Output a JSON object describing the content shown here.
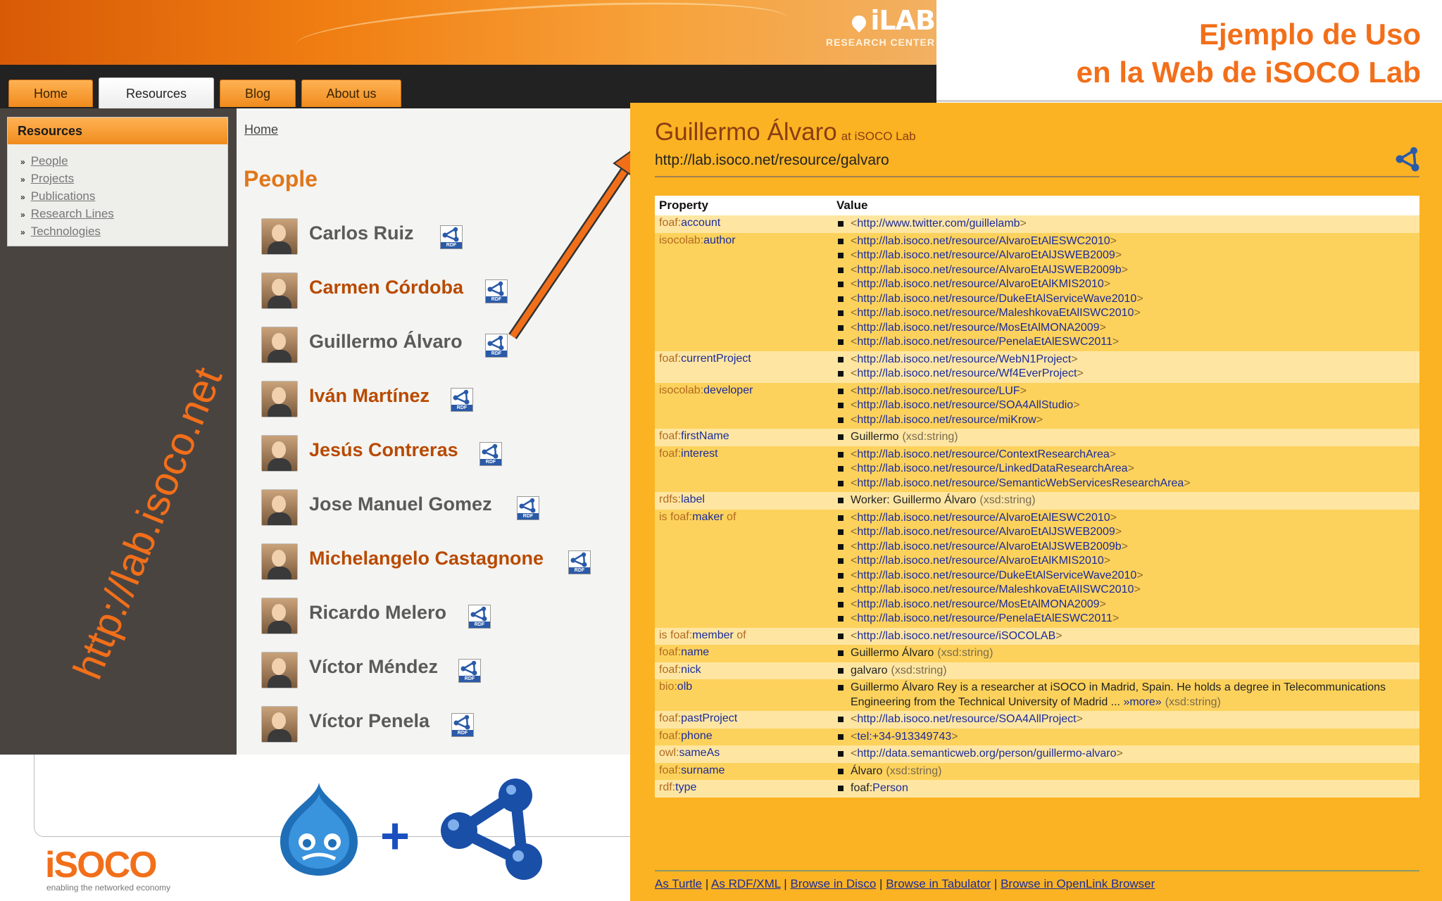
{
  "site": {
    "logo": "iLAB",
    "logo_sub": "RESEARCH CENTER",
    "nav": [
      "Home",
      "Resources",
      "Blog",
      "About us"
    ],
    "active_tab": "Resources"
  },
  "sidebar": {
    "heading": "Resources",
    "items": [
      "People",
      "Projects",
      "Publications",
      "Research Lines",
      "Technologies"
    ]
  },
  "rotated_url": "http://lab.isoco.net",
  "breadcrumb": "Home",
  "page_title": "People",
  "people": [
    {
      "name": "Carlos Ruiz",
      "highlight": false
    },
    {
      "name": "Carmen Córdoba",
      "highlight": true
    },
    {
      "name": "Guillermo Álvaro",
      "highlight": false
    },
    {
      "name": "Iván Martínez",
      "highlight": true
    },
    {
      "name": "Jesús Contreras",
      "highlight": true
    },
    {
      "name": "Jose Manuel Gomez",
      "highlight": false
    },
    {
      "name": "Michelangelo Castagnone",
      "highlight": true
    },
    {
      "name": "Ricardo Melero",
      "highlight": false
    },
    {
      "name": "Víctor Méndez",
      "highlight": false
    },
    {
      "name": "Víctor Penela",
      "highlight": false
    }
  ],
  "rdf_icon_label": "RDF",
  "slide_title": [
    "Ejemplo de Uso",
    "en la Web de iSOCO Lab"
  ],
  "isoco": {
    "logo": "iSOCO",
    "tagline": "enabling the networked economy"
  },
  "plus_sign": "+",
  "resource": {
    "name": "Guillermo Álvaro",
    "at": "at iSOCO Lab",
    "uri": "http://lab.isoco.net/resource/galvaro",
    "columns": [
      "Property",
      "Value"
    ],
    "rows": [
      {
        "prefix": "foaf:",
        "local": "account",
        "suffix": "",
        "values": [
          {
            "uri": "http://www.twitter.com/guillelamb"
          }
        ]
      },
      {
        "prefix": "isocolab:",
        "local": "author",
        "suffix": "",
        "values": [
          {
            "uri": "http://lab.isoco.net/resource/AlvaroEtAlESWC2010"
          },
          {
            "uri": "http://lab.isoco.net/resource/AlvaroEtAlJSWEB2009"
          },
          {
            "uri": "http://lab.isoco.net/resource/AlvaroEtAlJSWEB2009b"
          },
          {
            "uri": "http://lab.isoco.net/resource/AlvaroEtAlKMIS2010"
          },
          {
            "uri": "http://lab.isoco.net/resource/DukeEtAlServiceWave2010"
          },
          {
            "uri": "http://lab.isoco.net/resource/MaleshkovaEtAlISWC2010"
          },
          {
            "uri": "http://lab.isoco.net/resource/MosEtAlMONA2009"
          },
          {
            "uri": "http://lab.isoco.net/resource/PenelaEtAlESWC2011"
          }
        ]
      },
      {
        "prefix": "foaf:",
        "local": "currentProject",
        "suffix": "",
        "values": [
          {
            "uri": "http://lab.isoco.net/resource/WebN1Project"
          },
          {
            "uri": "http://lab.isoco.net/resource/Wf4EverProject"
          }
        ]
      },
      {
        "prefix": "isocolab:",
        "local": "developer",
        "suffix": "",
        "values": [
          {
            "uri": "http://lab.isoco.net/resource/LUF"
          },
          {
            "uri": "http://lab.isoco.net/resource/SOA4AllStudio"
          },
          {
            "uri": "http://lab.isoco.net/resource/miKrow"
          }
        ]
      },
      {
        "prefix": "foaf:",
        "local": "firstName",
        "suffix": "",
        "values": [
          {
            "text": "Guillermo",
            "dt": "(xsd:string)"
          }
        ]
      },
      {
        "prefix": "foaf:",
        "local": "interest",
        "suffix": "",
        "values": [
          {
            "uri": "http://lab.isoco.net/resource/ContextResearchArea"
          },
          {
            "uri": "http://lab.isoco.net/resource/LinkedDataResearchArea"
          },
          {
            "uri": "http://lab.isoco.net/resource/SemanticWebServicesResearchArea"
          }
        ]
      },
      {
        "prefix": "rdfs:",
        "local": "label",
        "suffix": "",
        "values": [
          {
            "text": "Worker: Guillermo Álvaro",
            "dt": "(xsd:string)"
          }
        ]
      },
      {
        "prefix": "is foaf:",
        "local": "maker",
        "suffix": " of",
        "values": [
          {
            "uri": "http://lab.isoco.net/resource/AlvaroEtAlESWC2010"
          },
          {
            "uri": "http://lab.isoco.net/resource/AlvaroEtAlJSWEB2009"
          },
          {
            "uri": "http://lab.isoco.net/resource/AlvaroEtAlJSWEB2009b"
          },
          {
            "uri": "http://lab.isoco.net/resource/AlvaroEtAlKMIS2010"
          },
          {
            "uri": "http://lab.isoco.net/resource/DukeEtAlServiceWave2010"
          },
          {
            "uri": "http://lab.isoco.net/resource/MaleshkovaEtAlISWC2010"
          },
          {
            "uri": "http://lab.isoco.net/resource/MosEtAlMONA2009"
          },
          {
            "uri": "http://lab.isoco.net/resource/PenelaEtAlESWC2011"
          }
        ]
      },
      {
        "prefix": "is foaf:",
        "local": "member",
        "suffix": " of",
        "values": [
          {
            "uri": "http://lab.isoco.net/resource/iSOCOLAB"
          }
        ]
      },
      {
        "prefix": "foaf:",
        "local": "name",
        "suffix": "",
        "values": [
          {
            "text": "Guillermo Álvaro",
            "dt": "(xsd:string)"
          }
        ]
      },
      {
        "prefix": "foaf:",
        "local": "nick",
        "suffix": "",
        "values": [
          {
            "text": "galvaro",
            "dt": "(xsd:string)"
          }
        ]
      },
      {
        "prefix": "bio:",
        "local": "olb",
        "suffix": "",
        "values": [
          {
            "text": "Guillermo Álvaro Rey is a researcher at iSOCO in Madrid, Spain. He holds a degree in Telecommunications Engineering from the Technical University of Madrid ...",
            "more": "»more»",
            "dt": "(xsd:string)"
          }
        ]
      },
      {
        "prefix": "foaf:",
        "local": "pastProject",
        "suffix": "",
        "values": [
          {
            "uri": "http://lab.isoco.net/resource/SOA4AllProject"
          }
        ]
      },
      {
        "prefix": "foaf:",
        "local": "phone",
        "suffix": "",
        "values": [
          {
            "uri": "tel:+34-913349743"
          }
        ]
      },
      {
        "prefix": "owl:",
        "local": "sameAs",
        "suffix": "",
        "values": [
          {
            "uri": "http://data.semanticweb.org/person/guillermo-alvaro"
          }
        ]
      },
      {
        "prefix": "foaf:",
        "local": "surname",
        "suffix": "",
        "values": [
          {
            "text": "Álvaro",
            "dt": "(xsd:string)"
          }
        ]
      },
      {
        "prefix": "rdf:",
        "local": "type",
        "suffix": "",
        "values": [
          {
            "text": "foaf:",
            "link": "Person"
          }
        ]
      }
    ],
    "footer_links": [
      "As Turtle",
      "As RDF/XML",
      "Browse in Disco",
      "Browse in Tabulator",
      "Browse in OpenLink Browser"
    ]
  },
  "colors": {
    "accent": "#f26f1a",
    "panel": "#fbb323",
    "link": "#1c2b9a"
  }
}
